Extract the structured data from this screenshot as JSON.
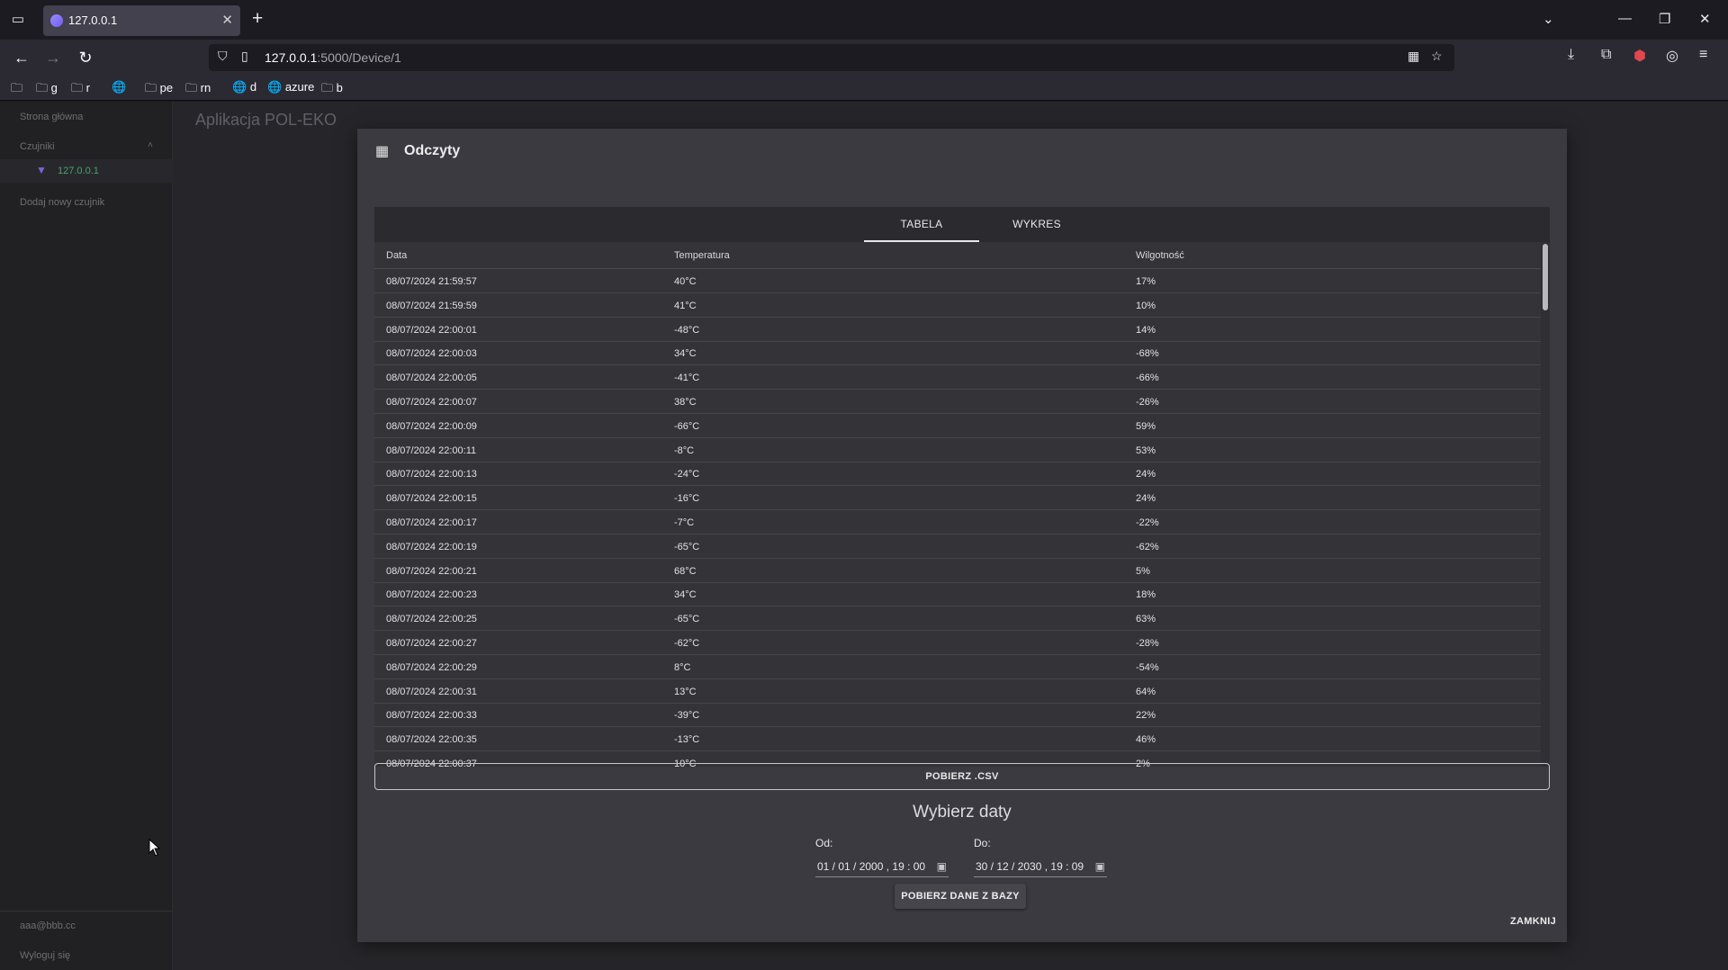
{
  "browser": {
    "tab_title": "127.0.0.1",
    "url_host": "127.0.0.1",
    "url_path": ":5000/Device/1",
    "bookmarks": [
      "g",
      "r",
      "pe",
      "rn",
      "d",
      "azure",
      "b"
    ]
  },
  "sidebar": {
    "home": "Strona główna",
    "sensors": "Czujniki",
    "sensor_item": "127.0.0.1",
    "add_sensor": "Dodaj nowy czujnik",
    "user_email": "aaa@bbb.cc",
    "logout": "Wyloguj się"
  },
  "app": {
    "title": "Aplikacja POL-EKO"
  },
  "modal": {
    "title": "Odczyty",
    "tabs": [
      "TABELA",
      "WYKRES"
    ],
    "columns": [
      "Data",
      "Temperatura",
      "Wilgotność"
    ],
    "rows": [
      [
        "08/07/2024 21:59:57",
        "40°C",
        "17%"
      ],
      [
        "08/07/2024 21:59:59",
        "41°C",
        "10%"
      ],
      [
        "08/07/2024 22:00:01",
        "-48°C",
        "14%"
      ],
      [
        "08/07/2024 22:00:03",
        "34°C",
        "-68%"
      ],
      [
        "08/07/2024 22:00:05",
        "-41°C",
        "-66%"
      ],
      [
        "08/07/2024 22:00:07",
        "38°C",
        "-26%"
      ],
      [
        "08/07/2024 22:00:09",
        "-66°C",
        "59%"
      ],
      [
        "08/07/2024 22:00:11",
        "-8°C",
        "53%"
      ],
      [
        "08/07/2024 22:00:13",
        "-24°C",
        "24%"
      ],
      [
        "08/07/2024 22:00:15",
        "-16°C",
        "24%"
      ],
      [
        "08/07/2024 22:00:17",
        "-7°C",
        "-22%"
      ],
      [
        "08/07/2024 22:00:19",
        "-65°C",
        "-62%"
      ],
      [
        "08/07/2024 22:00:21",
        "68°C",
        "5%"
      ],
      [
        "08/07/2024 22:00:23",
        "34°C",
        "18%"
      ],
      [
        "08/07/2024 22:00:25",
        "-65°C",
        "63%"
      ],
      [
        "08/07/2024 22:00:27",
        "-62°C",
        "-28%"
      ],
      [
        "08/07/2024 22:00:29",
        "8°C",
        "-54%"
      ],
      [
        "08/07/2024 22:00:31",
        "13°C",
        "64%"
      ],
      [
        "08/07/2024 22:00:33",
        "-39°C",
        "22%"
      ],
      [
        "08/07/2024 22:00:35",
        "-13°C",
        "46%"
      ],
      [
        "08/07/2024 22:00:37",
        "10°C",
        "2%"
      ]
    ],
    "csv_button": "POBIERZ .CSV",
    "date_heading": "Wybierz daty",
    "from_label": "Od:",
    "to_label": "Do:",
    "from_value": "01 / 01 / 2000 ,  19 : 00",
    "to_value": "30 / 12 / 2030 ,  19 : 09",
    "fetch_button": "POBIERZ DANE Z BAZY",
    "close_button": "ZAMKNIJ"
  }
}
